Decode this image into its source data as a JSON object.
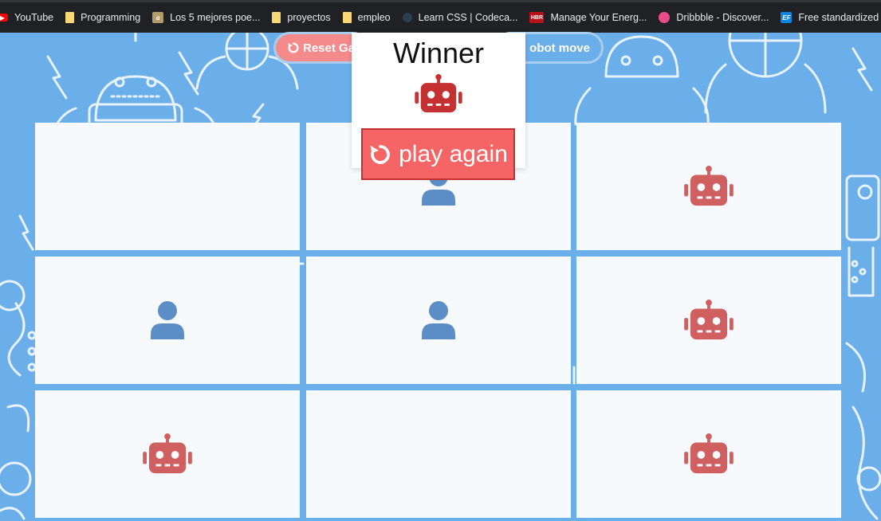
{
  "bookmarks": [
    {
      "label": "YouTube",
      "icon": "youtube-icon"
    },
    {
      "label": "Programming",
      "icon": "folder-icon"
    },
    {
      "label": "Los 5 mejores poe...",
      "icon": "poems-site-icon"
    },
    {
      "label": "proyectos",
      "icon": "folder-icon"
    },
    {
      "label": "empleo",
      "icon": "folder-icon"
    },
    {
      "label": "Learn CSS | Codeca...",
      "icon": "codecademy-icon"
    },
    {
      "label": "Manage Your Energ...",
      "icon": "hbr-icon"
    },
    {
      "label": "Dribbble - Discover...",
      "icon": "dribbble-icon"
    },
    {
      "label": "Free standardized",
      "icon": "ef-icon"
    }
  ],
  "controls": {
    "reset_label": "Reset Ga",
    "robot_label": "obot move"
  },
  "modal": {
    "title": "Winner",
    "winner_icon": "robot-icon",
    "play_again_label": "play again"
  },
  "board": {
    "cells": [
      "",
      "user",
      "robot",
      "user",
      "user",
      "robot",
      "robot",
      "",
      "robot"
    ]
  },
  "colors": {
    "background": "#6aaeea",
    "robot": "#d06060",
    "robot_winner": "#c53030",
    "user": "#5b8ec7",
    "play_again": "#f56565"
  }
}
